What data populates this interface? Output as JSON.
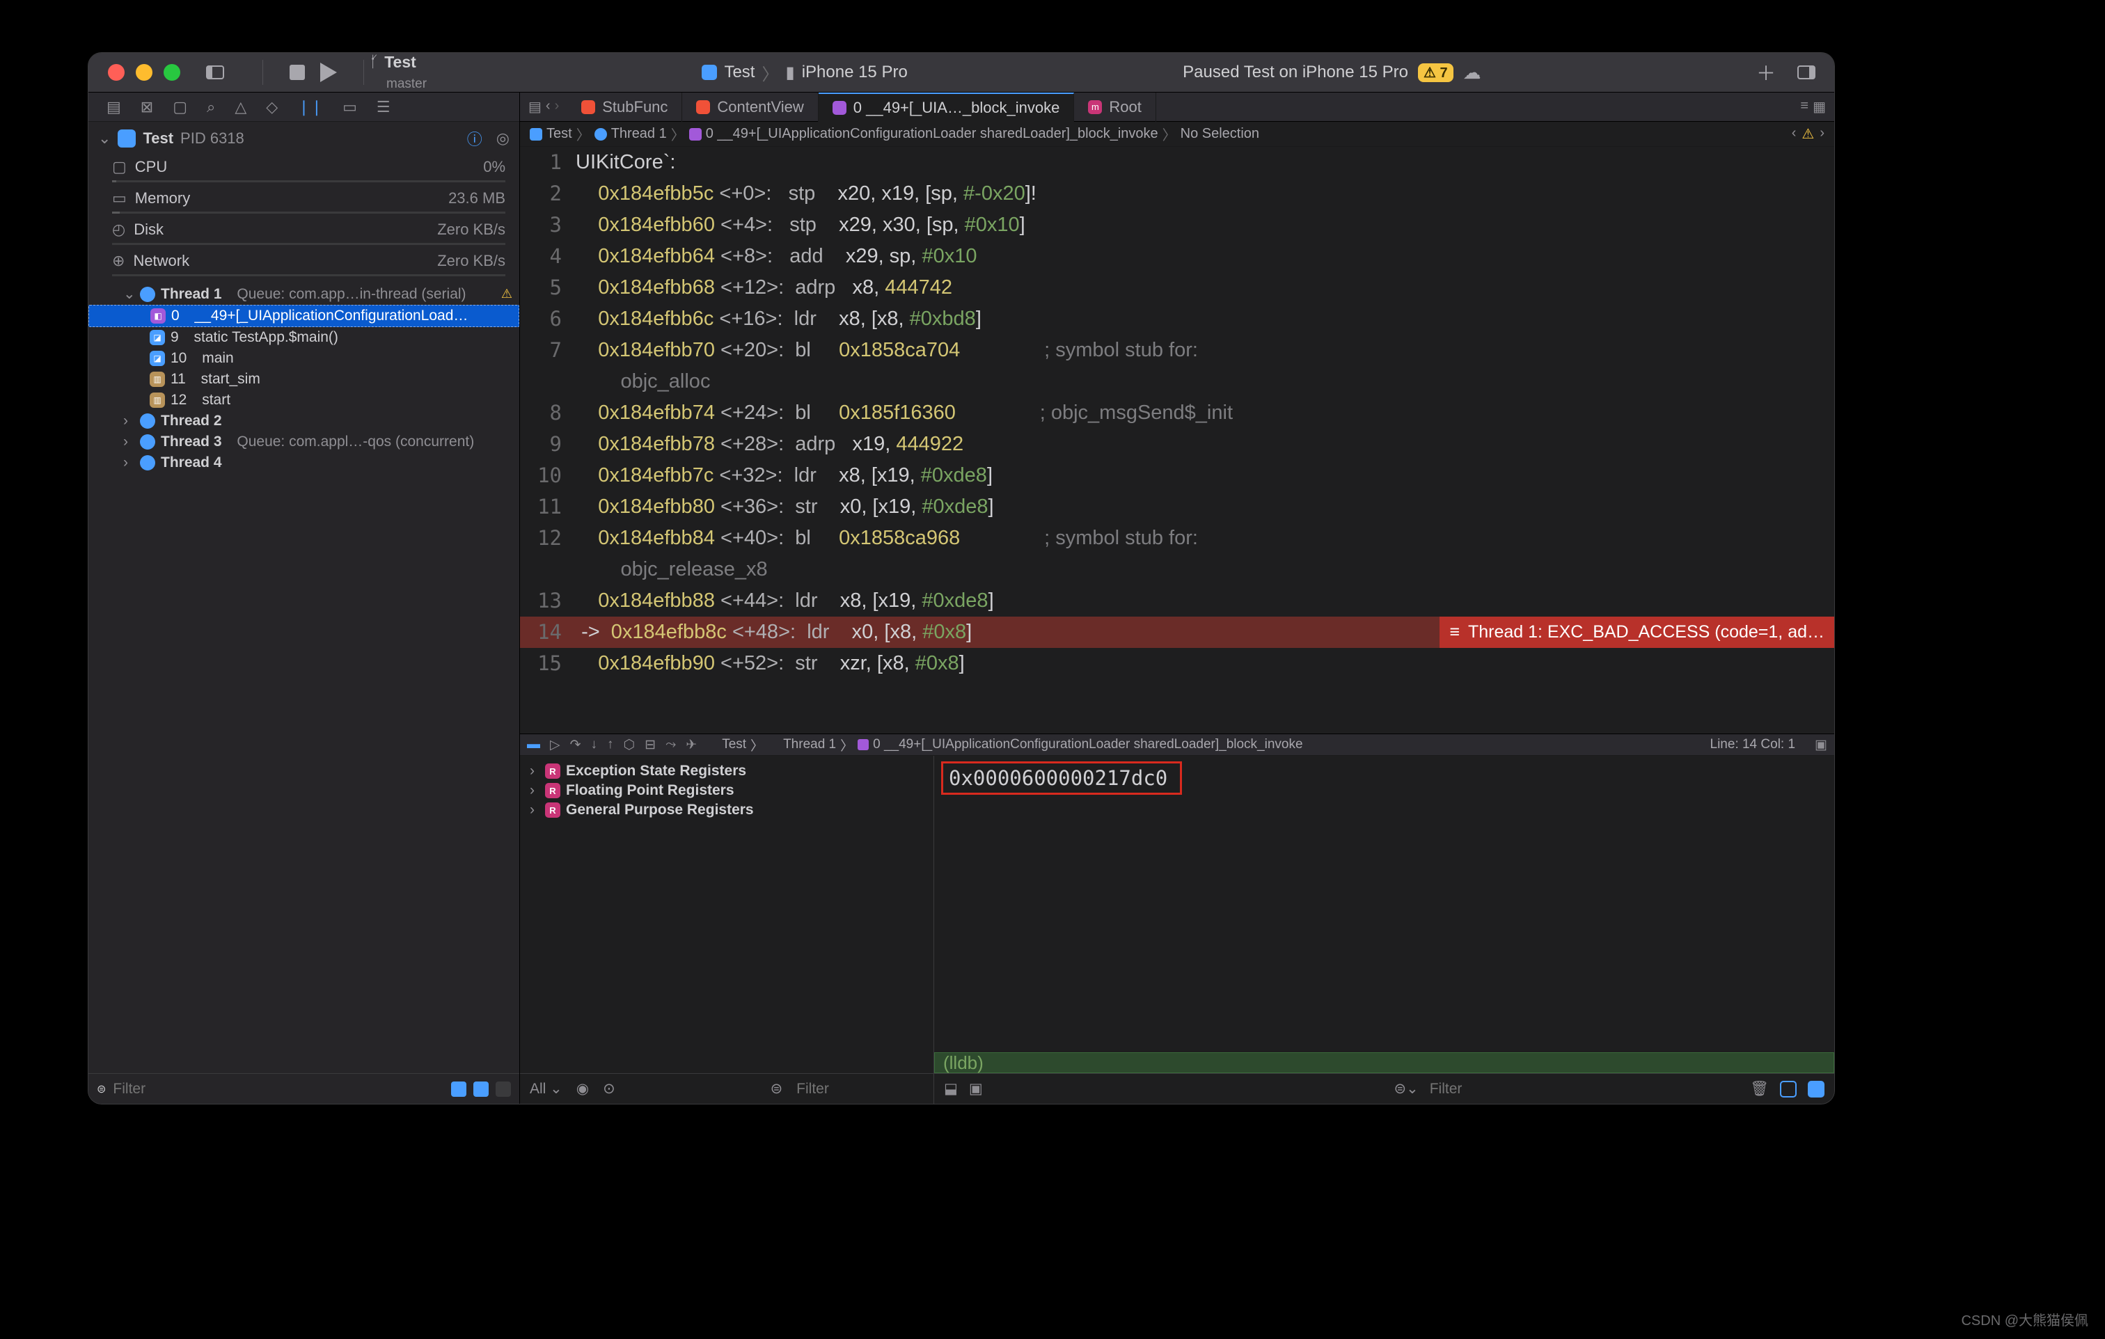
{
  "scheme": {
    "name": "Test",
    "branch": "master"
  },
  "run_target": {
    "scheme": "Test",
    "device": "iPhone 15 Pro"
  },
  "status": {
    "text": "Paused Test on iPhone 15 Pro",
    "warning_count": "7"
  },
  "process": {
    "name": "Test",
    "pid_label": "PID 6318",
    "cpu_label": "CPU",
    "cpu_val": "0%",
    "mem_label": "Memory",
    "mem_val": "23.6 MB",
    "disk_label": "Disk",
    "disk_val": "Zero KB/s",
    "net_label": "Network",
    "net_val": "Zero KB/s"
  },
  "threads": {
    "t1": {
      "name": "Thread 1",
      "detail": "Queue: com.app…in-thread (serial)"
    },
    "frames": [
      {
        "idx": "0",
        "name": "__49+[_UIApplicationConfigurationLoad…"
      },
      {
        "idx": "9",
        "name": "static TestApp.$main()"
      },
      {
        "idx": "10",
        "name": "main"
      },
      {
        "idx": "11",
        "name": "start_sim"
      },
      {
        "idx": "12",
        "name": "start"
      }
    ],
    "t2": "Thread 2",
    "t3": {
      "name": "Thread 3",
      "detail": "Queue: com.appl…-qos (concurrent)"
    },
    "t4": "Thread 4"
  },
  "sidebar_filter_placeholder": "Filter",
  "tabs": {
    "t0": "StubFunc",
    "t1": "ContentView",
    "t2": "0 __49+[_UIA…_block_invoke",
    "t3": "Root"
  },
  "jump": {
    "p0": "Test",
    "p1": "Thread 1",
    "p2": "0 __49+[_UIApplicationConfigurationLoader sharedLoader]_block_invoke",
    "p3": "No Selection"
  },
  "code": {
    "l1": {
      "n": "1",
      "t": "UIKitCore`:"
    },
    "l2": {
      "n": "2",
      "a": "0x184efbb5c",
      "o": "<+0>:",
      "i": "stp",
      "r": "x20, x19, [sp, ",
      "h": "#-0x20",
      "t": "]!"
    },
    "l3": {
      "n": "3",
      "a": "0x184efbb60",
      "o": "<+4>:",
      "i": "stp",
      "r": "x29, x30, [sp, ",
      "h": "#0x10",
      "t": "]"
    },
    "l4": {
      "n": "4",
      "a": "0x184efbb64",
      "o": "<+8>:",
      "i": "add",
      "r": "x29, sp, ",
      "h": "#0x10"
    },
    "l5": {
      "n": "5",
      "a": "0x184efbb68",
      "o": "<+12>:",
      "i": "adrp",
      "r": "x8, ",
      "v": "444742"
    },
    "l6": {
      "n": "6",
      "a": "0x184efbb6c",
      "o": "<+16>:",
      "i": "ldr",
      "r": "x8, [x8, ",
      "h": "#0xbd8",
      "t": "]"
    },
    "l7": {
      "n": "7",
      "a": "0x184efbb70",
      "o": "<+20>:",
      "i": "bl",
      "tg": "0x1858ca704",
      "c": "; symbol stub for: "
    },
    "l7b": {
      "t": "objc_alloc"
    },
    "l8": {
      "n": "8",
      "a": "0x184efbb74",
      "o": "<+24>:",
      "i": "bl",
      "tg": "0x185f16360",
      "c": "; objc_msgSend$_init"
    },
    "l9": {
      "n": "9",
      "a": "0x184efbb78",
      "o": "<+28>:",
      "i": "adrp",
      "r": "x19, ",
      "v": "444922"
    },
    "l10": {
      "n": "10",
      "a": "0x184efbb7c",
      "o": "<+32>:",
      "i": "ldr",
      "r": "x8, [x19, ",
      "h": "#0xde8",
      "t": "]"
    },
    "l11": {
      "n": "11",
      "a": "0x184efbb80",
      "o": "<+36>:",
      "i": "str",
      "r": "x0, [x19, ",
      "h": "#0xde8",
      "t": "]"
    },
    "l12": {
      "n": "12",
      "a": "0x184efbb84",
      "o": "<+40>:",
      "i": "bl",
      "tg": "0x1858ca968",
      "c": "; symbol stub for: "
    },
    "l12b": {
      "t": "objc_release_x8"
    },
    "l13": {
      "n": "13",
      "a": "0x184efbb88",
      "o": "<+44>:",
      "i": "ldr",
      "r": "x8, [x19, ",
      "h": "#0xde8",
      "t": "]"
    },
    "l14": {
      "n": "14",
      "a": "0x184efbb8c",
      "o": "<+48>:",
      "i": "ldr",
      "r": "x0, [x8, ",
      "h": "#0x8",
      "t": "]"
    },
    "l15": {
      "n": "15",
      "a": "0x184efbb90",
      "o": "<+52>:",
      "i": "str",
      "r": "xzr, [x8, ",
      "h": "#0x8",
      "t": "]"
    }
  },
  "error_msg": "Thread 1: EXC_BAD_ACCESS (code=1, ad…",
  "dbg_bar": {
    "p0": "Test",
    "p1": "Thread 1",
    "p2": "0 __49+[_UIApplicationConfigurationLoader sharedLoader]_block_invoke",
    "status": "Line: 14  Col: 1"
  },
  "registers": {
    "r0": "Exception State Registers",
    "r1": "Floating Point Registers",
    "r2": "General Purpose Registers"
  },
  "vars_foot": {
    "scope": "All"
  },
  "value_display": "0x0000600000217dc0",
  "val_foot_placeholder": "Filter",
  "console_prompt": "(lldb) ",
  "cons_foot_placeholder": "Filter",
  "watermark": "CSDN @大熊猫侯佩"
}
